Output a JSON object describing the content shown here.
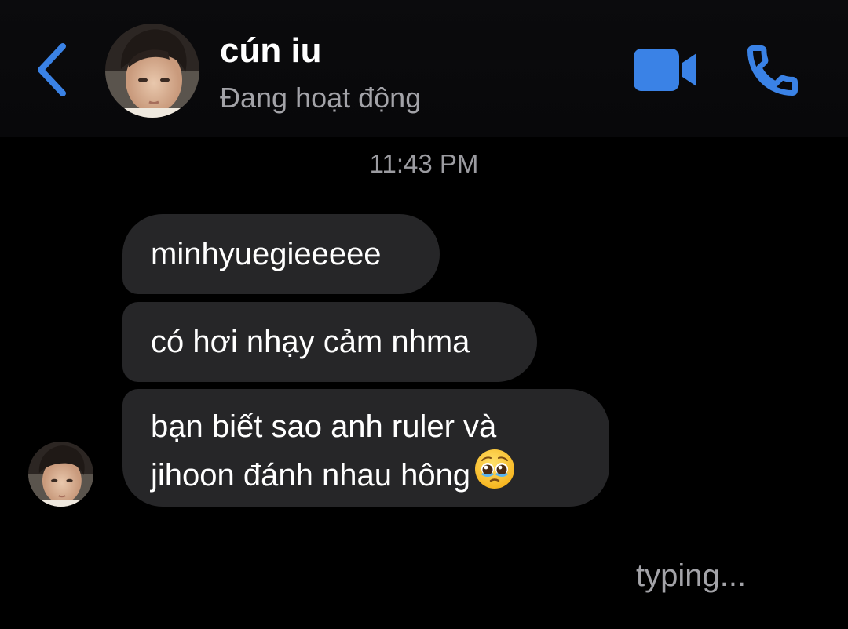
{
  "header": {
    "name": "cún iu",
    "status": "Đang hoạt động",
    "back_icon": "chevron-left-icon",
    "video_icon": "video-camera-icon",
    "call_icon": "phone-icon",
    "accent_color": "#3a82e6"
  },
  "chat": {
    "timestamp": "11:43 PM",
    "messages": [
      {
        "lines": [
          "minhyuegieeeee"
        ]
      },
      {
        "lines": [
          "có hơi nhạy cảm nhma"
        ]
      },
      {
        "lines": [
          "bạn biết sao anh ruler và",
          "jihoon đánh nhau hông"
        ],
        "emoji": "pleading-face"
      }
    ],
    "bubble_color": "#262628",
    "typing_indicator": "typing..."
  }
}
